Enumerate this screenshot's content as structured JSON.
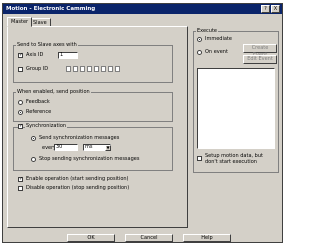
{
  "window": {
    "title": "Motion - Electronic Camming",
    "help_label": "?",
    "close_label": "X"
  },
  "tabs": [
    {
      "label": "Master"
    },
    {
      "label": "Slave"
    }
  ],
  "send_group": {
    "title": "Send to Slave axes with",
    "axis_id": {
      "label": "Axis ID",
      "value": "1",
      "checked": true
    },
    "group_id": {
      "label": "Group ID",
      "checked": false,
      "count": 8
    }
  },
  "position_group": {
    "title": "When enabled, send position",
    "options": [
      {
        "label": "Feedback",
        "selected": false
      },
      {
        "label": "Reference",
        "selected": true
      }
    ]
  },
  "sync_group": {
    "title": "Synchronization",
    "checked": true,
    "send_sync": {
      "label": "Send synchronization messages",
      "selected": true
    },
    "every_label": "every",
    "every_value": "30",
    "unit_value": "ms",
    "stop_sync": {
      "label": "Stop sending synchronization messages",
      "selected": false
    }
  },
  "operation": {
    "enable": {
      "label": "Enable operation (start sending position)",
      "checked": true
    },
    "disable": {
      "label": "Disable operation (stop sending position)",
      "checked": false
    }
  },
  "execute_group": {
    "title": "Execute",
    "immediate": {
      "label": "Immediate",
      "selected": true
    },
    "on_event": {
      "label": "On event",
      "selected": false
    },
    "create_event_label": "Create Event",
    "edit_event_label": "Edit Event",
    "setup_note": "Setup motion data, but don't start execution"
  },
  "buttons": {
    "ok": "OK",
    "cancel": "Cancel",
    "help": "Help"
  }
}
